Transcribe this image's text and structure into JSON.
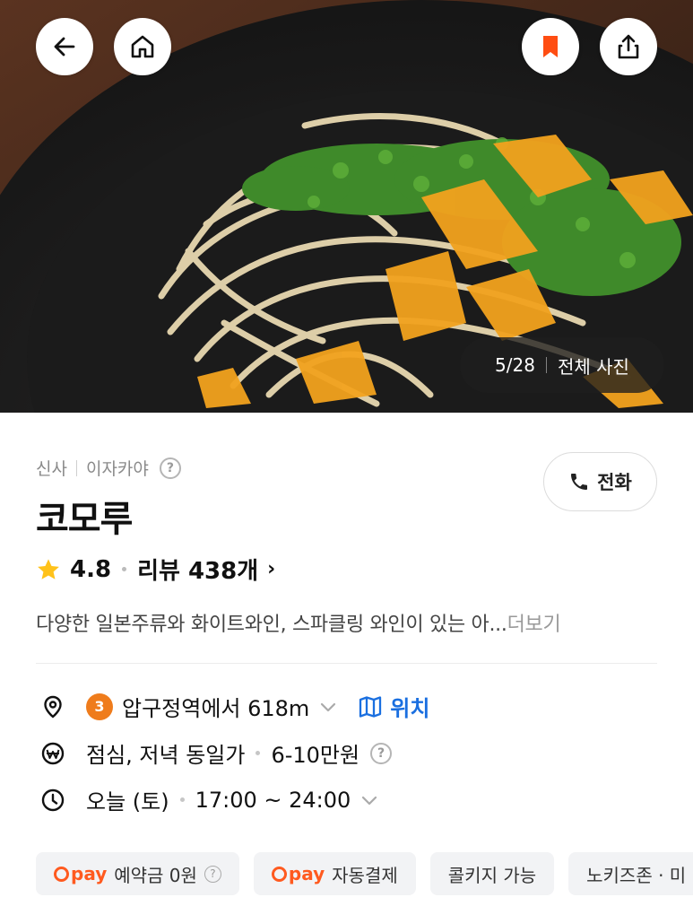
{
  "photo": {
    "current": "5/28",
    "all_label": "전체 사진"
  },
  "restaurant": {
    "area": "신사",
    "category": "이자카야",
    "name": "코모루",
    "rating": "4.8",
    "review_label": "리뷰 438개",
    "description": "다양한 일본주류와 화이트와인, 스파클링 와인이 있는 아...",
    "more_label": "더보기"
  },
  "call_button": {
    "label": "전화"
  },
  "location": {
    "line_number": "3",
    "text": "압구정역에서 618m",
    "map_label": "위치"
  },
  "price": {
    "meal": "점심, 저녁 동일가",
    "range": "6-10만원"
  },
  "hours": {
    "day": "오늘 (토)",
    "time": "17:00 ~ 24:00"
  },
  "chips": [
    {
      "pay": "pay",
      "label": "예약금 0원",
      "help": "?"
    },
    {
      "pay": "pay",
      "label": "자동결제"
    },
    {
      "label": "콜키지 가능"
    },
    {
      "label": "노키즈존 · 미"
    }
  ],
  "colors": {
    "accent_orange": "#ff5a1f",
    "bookmark": "#ff4d12",
    "link_blue": "#1a6fe0",
    "subway_line3": "#ef7c1c",
    "star": "#ffc21a"
  },
  "icons": [
    "back-arrow-icon",
    "home-icon",
    "bookmark-icon",
    "share-icon",
    "phone-icon",
    "star-icon",
    "location-pin-icon",
    "map-icon",
    "won-icon",
    "clock-icon",
    "chevron-down-icon",
    "help-icon"
  ]
}
